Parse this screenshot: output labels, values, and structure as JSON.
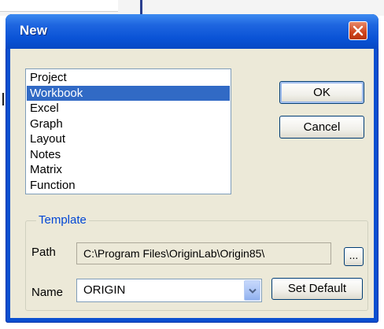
{
  "dialog": {
    "title": "New",
    "list_items": [
      {
        "label": "Project",
        "selected": false
      },
      {
        "label": "Workbook",
        "selected": true
      },
      {
        "label": "Excel",
        "selected": false
      },
      {
        "label": "Graph",
        "selected": false
      },
      {
        "label": "Layout",
        "selected": false
      },
      {
        "label": "Notes",
        "selected": false
      },
      {
        "label": "Matrix",
        "selected": false
      },
      {
        "label": "Function",
        "selected": false
      }
    ],
    "ok_label": "OK",
    "cancel_label": "Cancel"
  },
  "template": {
    "group_label": "Template",
    "path_label": "Path",
    "path_value": "C:\\Program Files\\OriginLab\\Origin85\\",
    "browse_label": "...",
    "name_label": "Name",
    "name_value": "ORIGIN",
    "set_default_label": "Set Default"
  },
  "icons": {
    "close": "close-icon",
    "dropdown": "chevron-down-icon"
  },
  "colors": {
    "titlebar": "#0a53d6",
    "selection": "#316ac5",
    "group_label": "#0046d5",
    "close_button": "#d0441c"
  }
}
